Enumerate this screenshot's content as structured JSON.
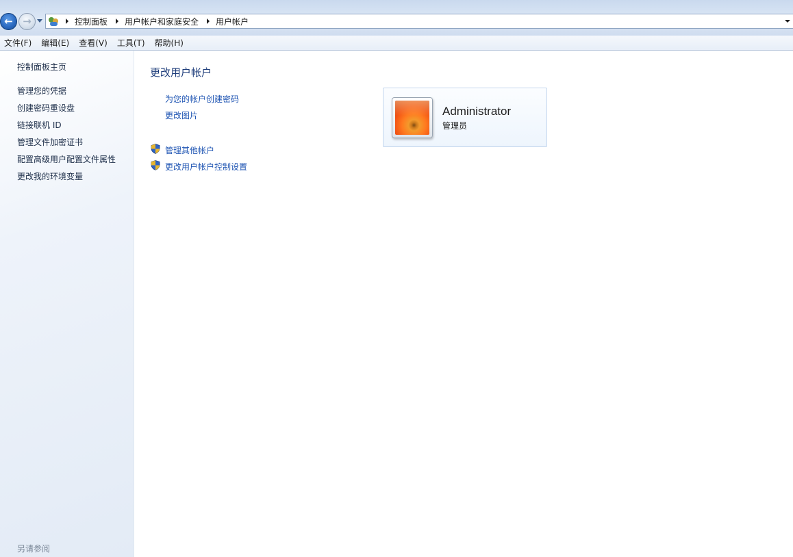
{
  "address_bar": {
    "crumbs": [
      "控制面板",
      "用户帐户和家庭安全",
      "用户帐户"
    ]
  },
  "menu": {
    "items": [
      "文件(F)",
      "编辑(E)",
      "查看(V)",
      "工具(T)",
      "帮助(H)"
    ]
  },
  "left_pane": {
    "home": "控制面板主页",
    "links": [
      "管理您的凭据",
      "创建密码重设盘",
      "链接联机 ID",
      "管理文件加密证书",
      "配置高级用户配置文件属性",
      "更改我的环境变量"
    ],
    "see_also": "另请参阅"
  },
  "main": {
    "title": "更改用户帐户",
    "tasks": [
      "为您的帐户创建密码",
      "更改图片"
    ],
    "admin_tasks": [
      "管理其他帐户",
      "更改用户帐户控制设置"
    ]
  },
  "account": {
    "name": "Administrator",
    "role": "管理员"
  },
  "colors": {
    "link": "#1f55b3",
    "title": "#1d3c7a",
    "left_text": "#1e2f4a"
  }
}
